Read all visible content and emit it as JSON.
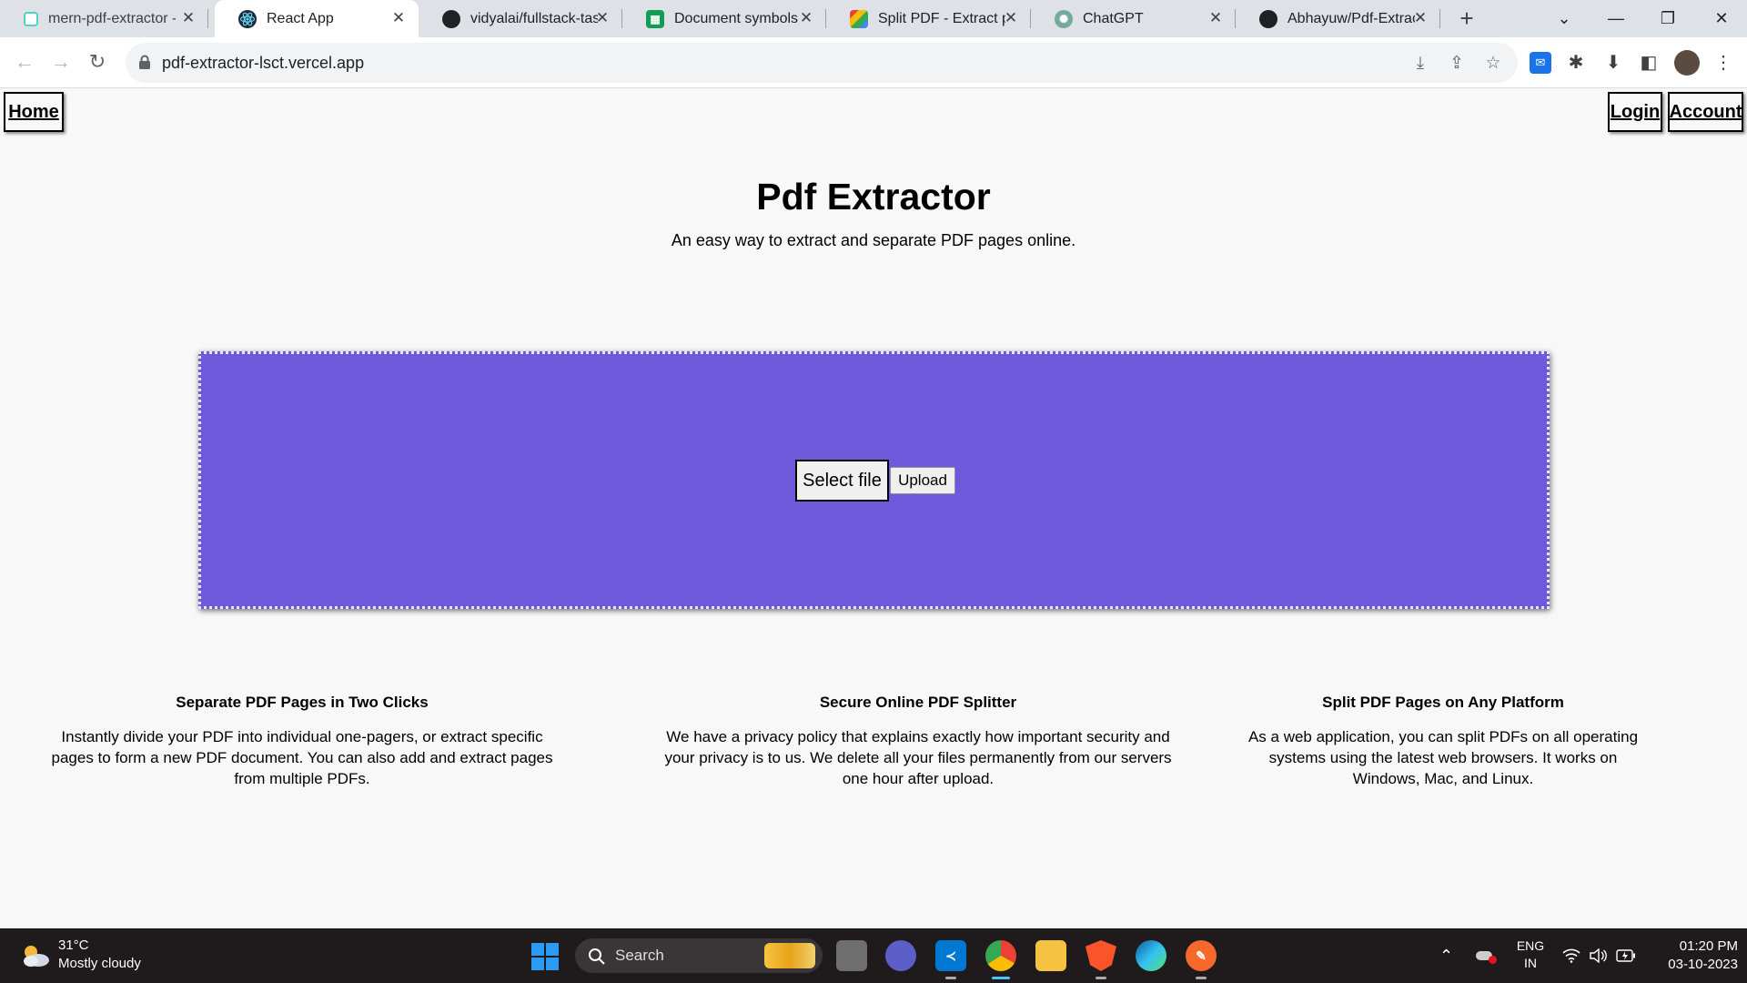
{
  "browser": {
    "tabs": [
      {
        "title": "mern-pdf-extractor -",
        "favicon": "replit-icon",
        "color": "#4fd1c5"
      },
      {
        "title": "React App",
        "favicon": "react-icon",
        "color": "#1f2937"
      },
      {
        "title": "vidyalai/fullstack-task",
        "favicon": "github-icon",
        "color": "#202124"
      },
      {
        "title": "Document symbols a",
        "favicon": "sheets-icon",
        "color": "#0f9d58"
      },
      {
        "title": "Split PDF - Extract pa",
        "favicon": "colorful-icon",
        "color": "#ea4335"
      },
      {
        "title": "ChatGPT",
        "favicon": "chatgpt-icon",
        "color": "#74aa9c"
      },
      {
        "title": "Abhayuw/Pdf-Extract",
        "favicon": "github-icon",
        "color": "#202124"
      }
    ],
    "active_tab": 1,
    "url": "pdf-extractor-lsct.vercel.app"
  },
  "page": {
    "nav": {
      "home": "Home",
      "login": "Login",
      "account": "Account"
    },
    "title": "Pdf Extractor",
    "subtitle": "An easy way to extract and separate PDF pages online.",
    "dropzone": {
      "select_label": "Select file",
      "upload_label": "Upload",
      "bg_color": "#6d59d9"
    },
    "features": [
      {
        "heading": "Separate PDF Pages in Two Clicks",
        "text": "Instantly divide your PDF into individual one-pagers, or extract specific pages to form a new PDF document. You can also add and extract pages from multiple PDFs."
      },
      {
        "heading": "Secure Online PDF Splitter",
        "text": "We have a privacy policy that explains exactly how important security and your privacy is to us. We delete all your files permanently from our servers one hour after upload."
      },
      {
        "heading": "Split PDF Pages on Any Platform",
        "text": "As a web application, you can split PDFs on all operating systems using the latest web browsers. It works on Windows, Mac, and Linux."
      }
    ]
  },
  "taskbar": {
    "weather_temp": "31°C",
    "weather_desc": "Mostly cloudy",
    "search_placeholder": "Search",
    "lang_line1": "ENG",
    "lang_line2": "IN",
    "time": "01:20 PM",
    "date": "03-10-2023"
  }
}
